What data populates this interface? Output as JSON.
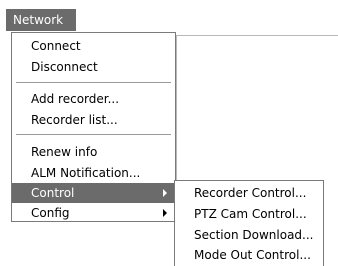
{
  "menubar": {
    "network_label": "Network"
  },
  "menu": {
    "items": [
      {
        "label": "Connect"
      },
      {
        "label": "Disconnect"
      },
      {
        "label": "Add recorder..."
      },
      {
        "label": "Recorder list..."
      },
      {
        "label": "Renew info"
      },
      {
        "label": "ALM Notification..."
      },
      {
        "label": "Control"
      },
      {
        "label": "Config"
      }
    ]
  },
  "submenu": {
    "items": [
      {
        "label": "Recorder Control..."
      },
      {
        "label": "PTZ Cam Control..."
      },
      {
        "label": "Section Download..."
      },
      {
        "label": "Mode Out Control..."
      }
    ]
  },
  "colors": {
    "highlight": "#6b6b6b",
    "highlight_text": "#ffffff"
  }
}
